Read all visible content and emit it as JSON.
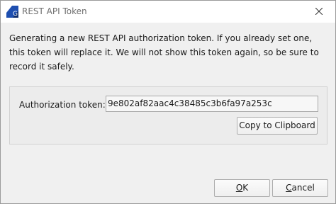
{
  "window": {
    "title": "REST API Token",
    "app_icon": "app-logo-icon",
    "close_icon": "close-icon"
  },
  "message": "Generating a new REST API authorization token. If you already set one, this token will replace it. We will not show this token again, so be sure to record it safely.",
  "token": {
    "label": "Authorization token:",
    "value": "9e802af82aac4c38485c3b6fa97a253c",
    "copy_label": "Copy to Clipboard"
  },
  "buttons": {
    "ok": {
      "mnemonic": "O",
      "rest": "K"
    },
    "cancel": {
      "mnemonic": "C",
      "rest": "ancel"
    }
  },
  "colors": {
    "accent": "#1e4fb0",
    "background": "#f0f0f0"
  }
}
